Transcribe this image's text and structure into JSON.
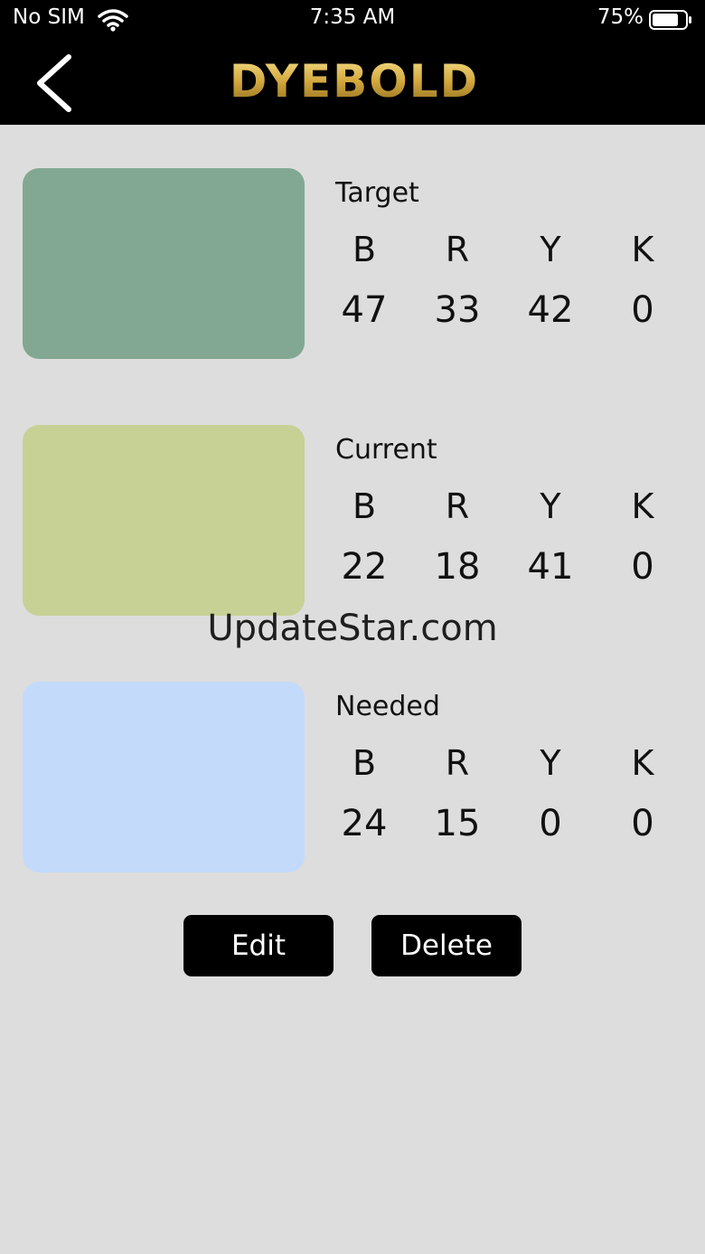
{
  "status_bar": {
    "carrier": "No SIM",
    "time": "7:35 AM",
    "battery": "75%",
    "icons": [
      "wifi-icon",
      "battery-icon"
    ]
  },
  "nav": {
    "logo_text": "DYEBOLD",
    "back_icon": "chevron-left-icon"
  },
  "channel_letters": [
    "B",
    "R",
    "Y",
    "K"
  ],
  "colors": [
    {
      "label": "Target",
      "swatch": "#82a793",
      "values": [
        "47",
        "33",
        "42",
        "0"
      ]
    },
    {
      "label": "Current",
      "swatch": "#c7d196",
      "values": [
        "22",
        "18",
        "41",
        "0"
      ]
    },
    {
      "label": "Needed",
      "swatch": "#c3dafb",
      "values": [
        "24",
        "15",
        "0",
        "0"
      ]
    }
  ],
  "actions": {
    "edit_label": "Edit",
    "delete_label": "Delete"
  },
  "watermark": "UpdateStar.com",
  "theme": {
    "background": "#dddddd",
    "bar": "#000000",
    "logo_gold": "#d8b24a"
  }
}
